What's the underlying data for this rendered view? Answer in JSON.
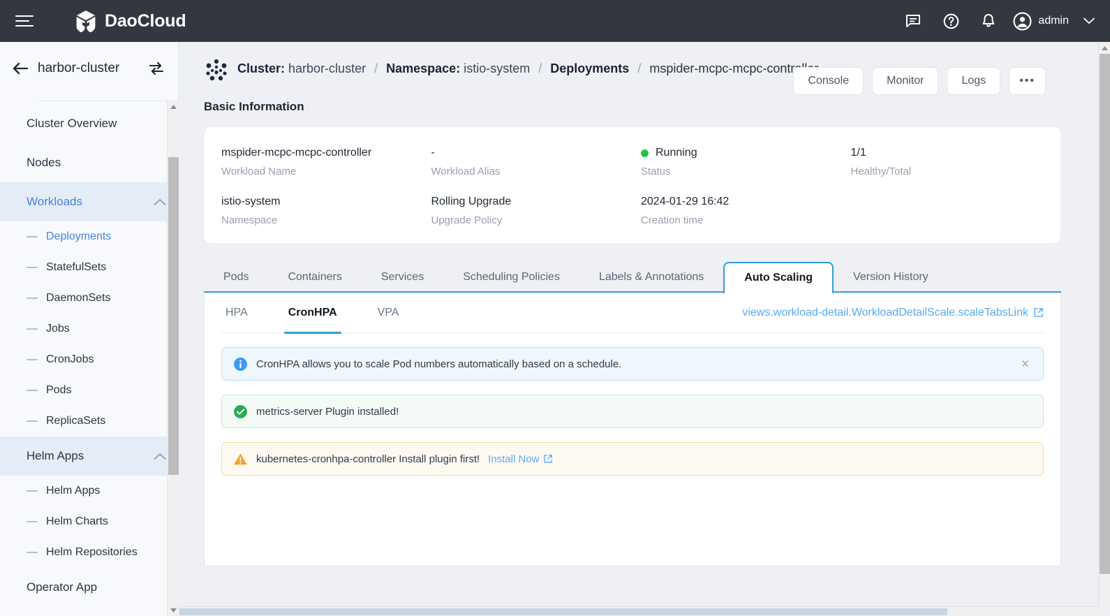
{
  "topbar": {
    "brand": "DaoCloud",
    "menu_icon": "hamburger-icon",
    "icons": [
      "message-icon",
      "help-icon",
      "bell-icon"
    ],
    "user": "admin"
  },
  "sidebar": {
    "cluster_name": "harbor-cluster",
    "back_icon": "arrow-left-icon",
    "switch_icon": "switch-cluster-icon",
    "items": [
      {
        "label": "Cluster Overview",
        "type": "item",
        "active": false
      },
      {
        "label": "Nodes",
        "type": "item",
        "active": false
      },
      {
        "label": "Workloads",
        "type": "group",
        "active": true,
        "expanded": true
      },
      {
        "label": "Deployments",
        "type": "sub",
        "active": true
      },
      {
        "label": "StatefulSets",
        "type": "sub",
        "active": false
      },
      {
        "label": "DaemonSets",
        "type": "sub",
        "active": false
      },
      {
        "label": "Jobs",
        "type": "sub",
        "active": false
      },
      {
        "label": "CronJobs",
        "type": "sub",
        "active": false
      },
      {
        "label": "Pods",
        "type": "sub",
        "active": false
      },
      {
        "label": "ReplicaSets",
        "type": "sub",
        "active": false
      },
      {
        "label": "Helm Apps",
        "type": "group",
        "active": true,
        "expanded": true
      },
      {
        "label": "Helm Apps",
        "type": "sub",
        "active": false
      },
      {
        "label": "Helm Charts",
        "type": "sub",
        "active": false
      },
      {
        "label": "Helm Repositories",
        "type": "sub",
        "active": false
      },
      {
        "label": "Operator App",
        "type": "group",
        "active": false,
        "expanded": false
      }
    ]
  },
  "breadcrumb": {
    "icon": "cluster-dots-icon",
    "cluster_label": "Cluster:",
    "cluster_value": "harbor-cluster",
    "namespace_label": "Namespace:",
    "namespace_value": "istio-system",
    "resource_label": "Deployments",
    "leaf": "mspider-mcpc-mcpc-controller",
    "separator": "/"
  },
  "page_actions": [
    {
      "label": "Console"
    },
    {
      "label": "Monitor"
    },
    {
      "label": "Logs"
    },
    {
      "label": "•••"
    }
  ],
  "basic_information": {
    "title": "Basic Information",
    "fields": [
      {
        "value": "mspider-mcpc-mcpc-controller",
        "label": "Workload Name"
      },
      {
        "value": "-",
        "label": "Workload Alias"
      },
      {
        "value": "Running",
        "label": "Status",
        "status_color": "#27c24c"
      },
      {
        "value": "1/1",
        "label": "Healthy/Total"
      },
      {
        "value": "istio-system",
        "label": "Namespace"
      },
      {
        "value": "Rolling Upgrade",
        "label": "Upgrade Policy"
      },
      {
        "value": "2024-01-29 16:42",
        "label": "Creation time"
      },
      {
        "value": "",
        "label": ""
      }
    ]
  },
  "tabs": [
    {
      "label": "Pods",
      "active": false
    },
    {
      "label": "Containers",
      "active": false
    },
    {
      "label": "Services",
      "active": false
    },
    {
      "label": "Scheduling Policies",
      "active": false
    },
    {
      "label": "Labels & Annotations",
      "active": false
    },
    {
      "label": "Auto Scaling",
      "active": true
    },
    {
      "label": "Version History",
      "active": false
    }
  ],
  "subtabs": [
    {
      "label": "HPA",
      "active": false
    },
    {
      "label": "CronHPA",
      "active": true
    },
    {
      "label": "VPA",
      "active": false
    }
  ],
  "scale_link": {
    "text": "views.workload-detail.WorkloadDetailScale.scaleTabsLink",
    "icon": "external-link-icon"
  },
  "alerts": [
    {
      "kind": "info",
      "icon": "info-circle-icon",
      "text": "CronHPA allows you to scale Pod numbers automatically based on a schedule.",
      "closable": true,
      "close_label": "×"
    },
    {
      "kind": "success",
      "icon": "check-circle-icon",
      "text": "metrics-server Plugin installed!",
      "closable": false
    },
    {
      "kind": "warn",
      "icon": "warning-triangle-icon",
      "text": "kubernetes-cronhpa-controller Install plugin first!",
      "link_text": "Install Now",
      "link_icon": "external-link-icon",
      "closable": false
    }
  ],
  "colors": {
    "topbar_bg": "#333740",
    "accent_blue": "#2e9fd4",
    "link_blue": "#57a9f5",
    "sidebar_active": "#4a82e0",
    "status_green": "#27c24c",
    "warn_orange": "#f0a32e"
  }
}
